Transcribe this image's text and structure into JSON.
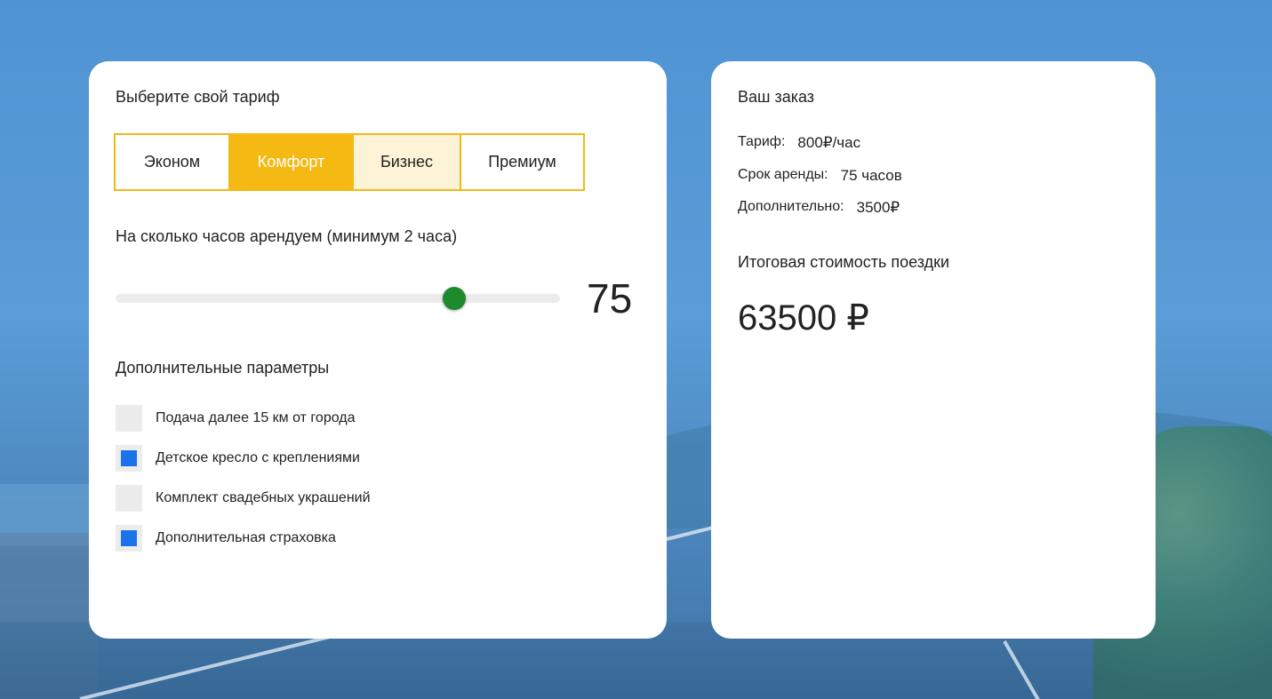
{
  "tariff": {
    "title": "Выберите свой тариф",
    "options": [
      {
        "label": "Эконом",
        "state": "normal"
      },
      {
        "label": "Комфорт",
        "state": "selected"
      },
      {
        "label": "Бизнес",
        "state": "hover"
      },
      {
        "label": "Премиум",
        "state": "normal"
      }
    ]
  },
  "hours": {
    "label": "На сколько часов арендуем (минимум 2 часа)",
    "value": "75",
    "slider_fraction": 0.75
  },
  "extras": {
    "title": "Дополнительные параметры",
    "items": [
      {
        "label": "Подача далее 15 км от города",
        "checked": false
      },
      {
        "label": "Детское кресло с креплениями",
        "checked": true
      },
      {
        "label": "Комплект свадебных украшений",
        "checked": false
      },
      {
        "label": "Дополнительная страховка",
        "checked": true
      }
    ]
  },
  "order": {
    "title": "Ваш заказ",
    "tariff_label": "Тариф:",
    "tariff_value": "800₽/час",
    "duration_label": "Срок аренды:",
    "duration_value": "75 часов",
    "extra_label": "Дополнительно:",
    "extra_value": "3500₽",
    "total_label": "Итоговая стоимость поездки",
    "total_value": "63500 ₽"
  },
  "colors": {
    "accent": "#f5b914",
    "slider_thumb": "#1e8a2e",
    "checkbox_checked": "#1a73e8"
  }
}
